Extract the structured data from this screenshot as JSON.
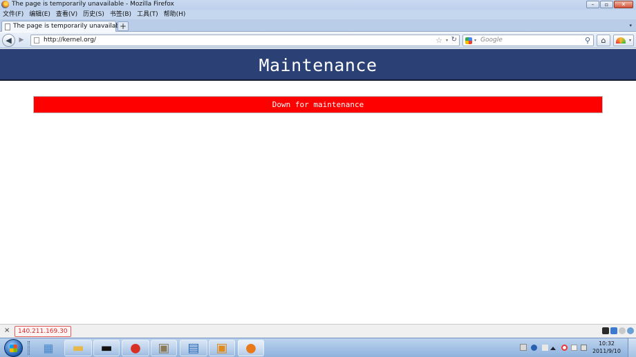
{
  "window": {
    "title": "The page is temporarily unavailable - Mozilla Firefox",
    "buttons": {
      "minimize": "–",
      "maximize": "▫",
      "close": "✕"
    }
  },
  "menu": {
    "items": [
      {
        "label": "文件(F)"
      },
      {
        "label": "编辑(E)"
      },
      {
        "label": "查看(V)"
      },
      {
        "label": "历史(S)"
      },
      {
        "label": "书签(B)"
      },
      {
        "label": "工具(T)"
      },
      {
        "label": "帮助(H)"
      }
    ]
  },
  "tabs": {
    "active_label": "The page is temporarily unavailable",
    "new_tab_label": "+",
    "list_glyph": "▾"
  },
  "nav": {
    "back_glyph": "◀",
    "forward_glyph": "▶",
    "url": "http://kernel.org/",
    "star_glyph": "☆",
    "dropdown_glyph": "▾",
    "reload_glyph": "↻",
    "search_placeholder": "Google",
    "search_glyph": "⚲",
    "home_glyph": "⌂"
  },
  "page": {
    "heading": "Maintenance",
    "banner": "Down for maintenance",
    "colors": {
      "header": "#2b4175",
      "banner": "#ff0000",
      "text": "#ffffff"
    }
  },
  "status": {
    "close_glyph": "×",
    "ip": "140.211.169.30"
  },
  "taskbar": {
    "apps": [
      {
        "name": "calculator-icon",
        "glyph": "▦",
        "color": "#4a88c8"
      },
      {
        "name": "explorer-icon",
        "glyph": "▬",
        "color": "#e6b84a"
      },
      {
        "name": "terminal-icon",
        "glyph": "▬",
        "color": "#111111"
      },
      {
        "name": "chrome-icon",
        "glyph": "●",
        "color": "#d93025"
      },
      {
        "name": "archive-icon",
        "glyph": "▣",
        "color": "#8a7a5a"
      },
      {
        "name": "remote-desktop-icon",
        "glyph": "▤",
        "color": "#2a6ab8"
      },
      {
        "name": "virtualbox-icon",
        "glyph": "▣",
        "color": "#e08a1c"
      },
      {
        "name": "firefox-icon",
        "glyph": "●",
        "color": "#e87a1c"
      }
    ],
    "clock": {
      "time": "10:32",
      "date": "2011/9/10"
    }
  }
}
